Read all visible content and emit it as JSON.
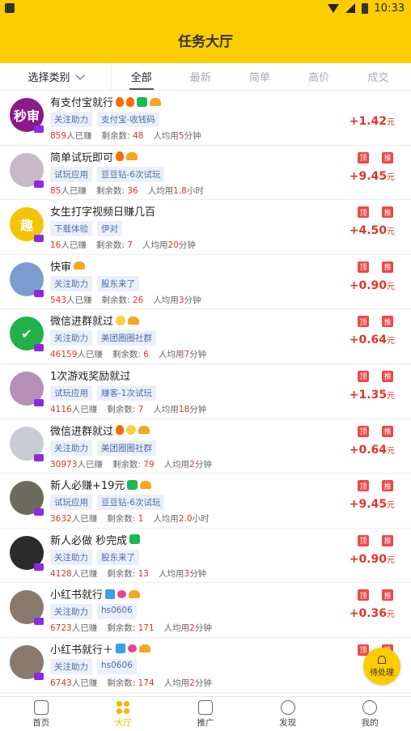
{
  "status_bar": {
    "time": "10:33"
  },
  "header": {
    "title": "任务大厅"
  },
  "filter": {
    "category_label": "选择类别",
    "tabs": [
      "全部",
      "最新",
      "简单",
      "高价",
      "成交"
    ]
  },
  "tasks": [
    {
      "title": "有支付宝就行",
      "icons": [
        "fire-icon",
        "fire-icon",
        "bao-icon",
        "hat-icon"
      ],
      "tags": [
        "关注助力",
        "支付宝-收钱码"
      ],
      "earned_count": "859",
      "earned_label": "人已赚",
      "remaining_label": "剩余数:",
      "remaining": "48",
      "avg_label": "人均用",
      "avg_value": "5",
      "avg_unit": "分钟",
      "reward": "+1.42",
      "reward_unit": "元",
      "flags": [],
      "avatar_text": "秒审",
      "avatar_color": "#8b1a8b"
    },
    {
      "title": "简单试玩即可",
      "icons": [
        "fire-icon",
        "hat-icon"
      ],
      "tags": [
        "试玩应用",
        "豆豆钻-6次试玩"
      ],
      "earned_count": "85",
      "earned_label": "人已赚",
      "remaining_label": "剩余数:",
      "remaining": "36",
      "avg_label": "人均用",
      "avg_value": "1.8",
      "avg_unit": "小时",
      "reward": "+9.45",
      "reward_unit": "元",
      "flags": [
        "顶",
        "推"
      ],
      "avatar_text": "",
      "avatar_color": "#c9b8c6"
    },
    {
      "title": "女生打字视频日赚几百",
      "icons": [],
      "tags": [
        "下载体验",
        "伊对"
      ],
      "earned_count": "16",
      "earned_label": "人已赚",
      "remaining_label": "剩余数:",
      "remaining": "7",
      "avg_label": "人均用",
      "avg_value": "20",
      "avg_unit": "分钟",
      "reward": "+4.50",
      "reward_unit": "元",
      "flags": [
        "顶",
        "推"
      ],
      "avatar_text": "趣",
      "avatar_color": "#f3c400"
    },
    {
      "title": "快审",
      "icons": [
        "hat-icon"
      ],
      "tags": [
        "关注助力",
        "股东来了"
      ],
      "earned_count": "543",
      "earned_label": "人已赚",
      "remaining_label": "剩余数:",
      "remaining": "26",
      "avg_label": "人均用",
      "avg_value": "3",
      "avg_unit": "分钟",
      "reward": "+0.90",
      "reward_unit": "元",
      "flags": [
        "顶",
        "推"
      ],
      "avatar_text": "",
      "avatar_color": "#7a9ccf"
    },
    {
      "title": "微信进群就过",
      "icons": [
        "emoji-icon",
        "hat-icon"
      ],
      "tags": [
        "关注助力",
        "美团圈圈社群"
      ],
      "earned_count": "46159",
      "earned_label": "人已赚",
      "remaining_label": "剩余数:",
      "remaining": "6",
      "avg_label": "人均用",
      "avg_value": "7",
      "avg_unit": "分钟",
      "reward": "+0.64",
      "reward_unit": "元",
      "flags": [
        "顶",
        "推"
      ],
      "avatar_text": "✔",
      "avatar_color": "#22b04b"
    },
    {
      "title": "1次游戏奖励就过",
      "icons": [],
      "tags": [
        "试玩应用",
        "赚客-1次试玩"
      ],
      "earned_count": "4116",
      "earned_label": "人已赚",
      "remaining_label": "剩余数:",
      "remaining": "7",
      "avg_label": "人均用",
      "avg_value": "18",
      "avg_unit": "分钟",
      "reward": "+1.35",
      "reward_unit": "元",
      "flags": [
        "顶",
        "推"
      ],
      "avatar_text": "",
      "avatar_color": "#b58fb8"
    },
    {
      "title": "微信进群就过",
      "icons": [
        "fire-icon",
        "emoji-icon",
        "hat-icon"
      ],
      "tags": [
        "关注助力",
        "美团圈圈社群"
      ],
      "earned_count": "30973",
      "earned_label": "人已赚",
      "remaining_label": "剩余数:",
      "remaining": "79",
      "avg_label": "人均用",
      "avg_value": "2",
      "avg_unit": "分钟",
      "reward": "+0.64",
      "reward_unit": "元",
      "flags": [
        "顶",
        "推"
      ],
      "avatar_text": "",
      "avatar_color": "#c8ccd2"
    },
    {
      "title": "新人必赚+19元",
      "icons": [
        "bao-icon",
        "hat-icon"
      ],
      "tags": [
        "试玩应用",
        "豆豆钻-6次试玩"
      ],
      "earned_count": "3632",
      "earned_label": "人已赚",
      "remaining_label": "剩余数:",
      "remaining": "1",
      "avg_label": "人均用",
      "avg_value": "2.0",
      "avg_unit": "小时",
      "reward": "+9.45",
      "reward_unit": "元",
      "flags": [
        "顶",
        "推"
      ],
      "avatar_text": "",
      "avatar_color": "#6d6a5e"
    },
    {
      "title": "新人必做 秒完成",
      "icons": [
        "bao-icon"
      ],
      "tags": [
        "关注助力",
        "股东来了"
      ],
      "earned_count": "4128",
      "earned_label": "人已赚",
      "remaining_label": "剩余数:",
      "remaining": "13",
      "avg_label": "人均用",
      "avg_value": "3",
      "avg_unit": "分钟",
      "reward": "+0.90",
      "reward_unit": "元",
      "flags": [
        "顶",
        "推"
      ],
      "avatar_text": "",
      "avatar_color": "#2b2b2b"
    },
    {
      "title": "小红书就行",
      "icons": [
        "kan-icon",
        "heart-icon",
        "hat-icon"
      ],
      "tags": [
        "关注助力",
        "hs0606"
      ],
      "earned_count": "6723",
      "earned_label": "人已赚",
      "remaining_label": "剩余数:",
      "remaining": "171",
      "avg_label": "人均用",
      "avg_value": "2",
      "avg_unit": "分钟",
      "reward": "+0.36",
      "reward_unit": "元",
      "flags": [
        "顶",
        "推"
      ],
      "avatar_text": "",
      "avatar_color": "#8a7a6d"
    },
    {
      "title": "小红书就行＋",
      "icons": [
        "kan-icon",
        "heart-icon",
        "hat-icon"
      ],
      "tags": [
        "关注助力",
        "hs0606"
      ],
      "earned_count": "6743",
      "earned_label": "人已赚",
      "remaining_label": "剩余数:",
      "remaining": "174",
      "avg_label": "人均用",
      "avg_value": "2",
      "avg_unit": "分钟",
      "reward": "+",
      "reward_unit": "",
      "flags": [
        "顶",
        "推"
      ],
      "avatar_text": "",
      "avatar_color": "#8a7a6d"
    }
  ],
  "floating_button": {
    "label": "待处理"
  },
  "bottom_nav": [
    {
      "label": "首页",
      "active": false
    },
    {
      "label": "大厅",
      "active": true
    },
    {
      "label": "推广",
      "active": false
    },
    {
      "label": "发现",
      "active": false
    },
    {
      "label": "我的",
      "active": false
    }
  ]
}
